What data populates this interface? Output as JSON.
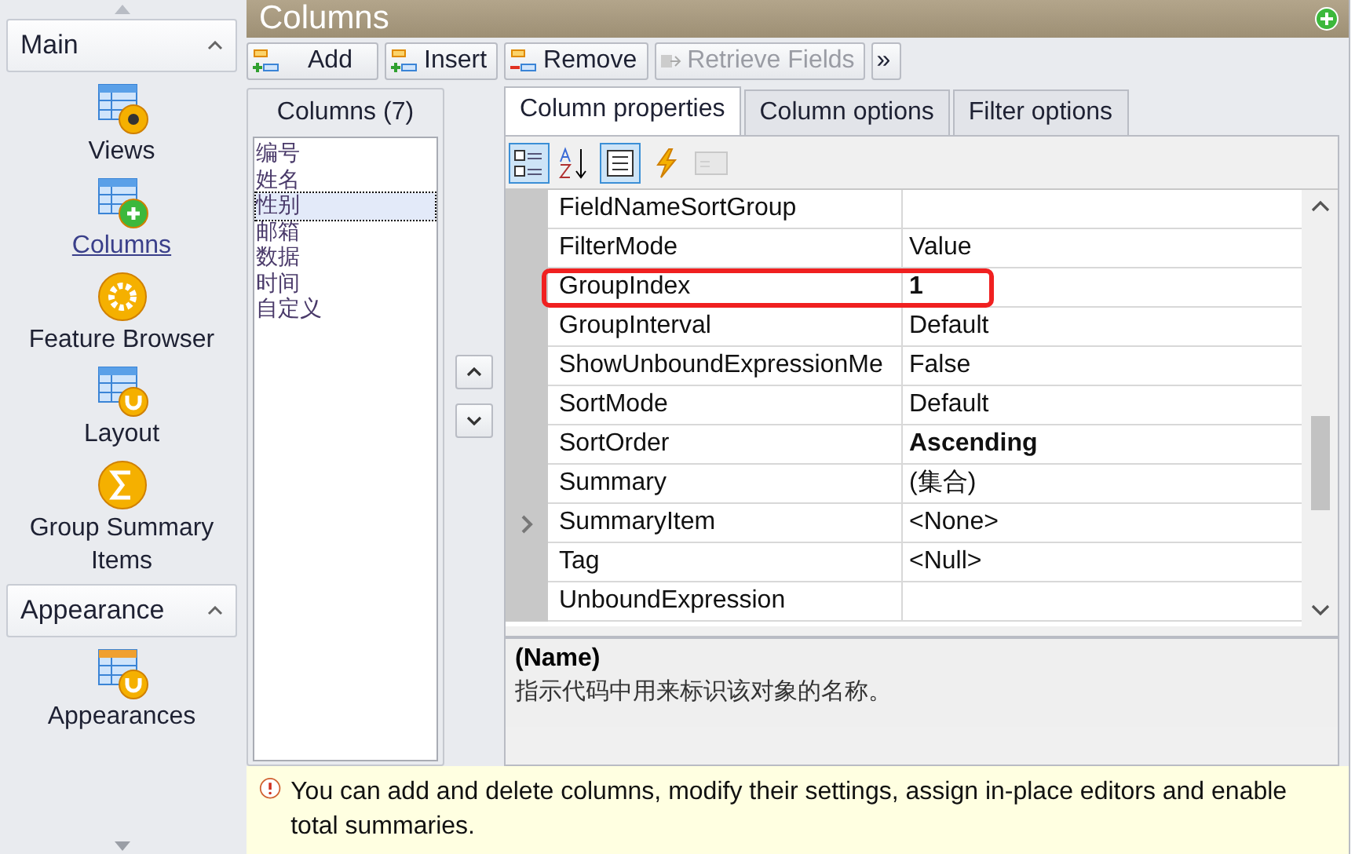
{
  "sidebar": {
    "groups": [
      {
        "title": "Main",
        "expanded": true,
        "items": [
          {
            "label": "Views",
            "kind": "view",
            "selected": false
          },
          {
            "label": "Columns",
            "kind": "columns",
            "selected": true
          },
          {
            "label": "Feature Browser",
            "kind": "feature",
            "selected": false
          },
          {
            "label": "Layout",
            "kind": "layout",
            "selected": false
          },
          {
            "label": "Group Summary Items",
            "kind": "summary",
            "selected": false
          }
        ]
      },
      {
        "title": "Appearance",
        "expanded": true,
        "items": [
          {
            "label": "Appearances",
            "kind": "appearance",
            "selected": false
          }
        ]
      }
    ]
  },
  "window": {
    "title": "Columns"
  },
  "toolbar": [
    {
      "label": "Add",
      "kind": "add",
      "disabled": false
    },
    {
      "label": "Insert",
      "kind": "insert",
      "disabled": false
    },
    {
      "label": "Remove",
      "kind": "remove",
      "disabled": false
    },
    {
      "label": "Retrieve Fields",
      "kind": "retrieve",
      "disabled": true
    },
    {
      "label": "»",
      "kind": "more",
      "disabled": false
    }
  ],
  "columns_panel": {
    "title": "Columns (7)",
    "items": [
      {
        "label": "编号",
        "selected": false
      },
      {
        "label": "姓名",
        "selected": false
      },
      {
        "label": "性别",
        "selected": true
      },
      {
        "label": "邮箱",
        "selected": false
      },
      {
        "label": "数据",
        "selected": false
      },
      {
        "label": "时间",
        "selected": false
      },
      {
        "label": "自定义",
        "selected": false
      }
    ]
  },
  "tabs": [
    {
      "label": "Column properties",
      "selected": true
    },
    {
      "label": "Column options",
      "selected": false
    },
    {
      "label": "Filter options",
      "selected": false
    }
  ],
  "grid_toolbar": [
    {
      "kind": "categorized",
      "selected": true,
      "disabled": false
    },
    {
      "kind": "alphabetical",
      "selected": false,
      "disabled": false
    },
    {
      "kind": "properties",
      "selected": true,
      "disabled": false
    },
    {
      "kind": "events",
      "selected": false,
      "disabled": false
    },
    {
      "kind": "pages",
      "selected": false,
      "disabled": true
    }
  ],
  "properties": [
    {
      "name": "FieldNameSortGroup",
      "current": false,
      "highlighted": false
    },
    {
      "name": "FilterMode",
      "value": "Value",
      "modified": false,
      "current": false,
      "highlighted": false
    },
    {
      "name": "GroupIndex",
      "value": "1",
      "modified": true,
      "current": false,
      "highlighted": true
    },
    {
      "name": "GroupInterval",
      "value": "Default",
      "modified": false,
      "current": false,
      "highlighted": false
    },
    {
      "name": "ShowUnboundExpressionMe",
      "value": "False",
      "modified": false,
      "current": false,
      "highlighted": false
    },
    {
      "name": "SortMode",
      "value": "Default",
      "modified": false,
      "current": false,
      "highlighted": false
    },
    {
      "name": "SortOrder",
      "value": "Ascending",
      "modified": true,
      "current": false,
      "highlighted": false
    },
    {
      "name": "Summary",
      "value": "(集合)",
      "modified": false,
      "current": false,
      "highlighted": false
    },
    {
      "name": "SummaryItem",
      "value": "<None>",
      "modified": false,
      "current": true,
      "highlighted": false
    },
    {
      "name": "Tag",
      "value": "<Null>",
      "modified": false,
      "current": false,
      "highlighted": false
    },
    {
      "name": "UnboundExpression",
      "current": false,
      "highlighted": false
    }
  ],
  "description": {
    "title": "(Name)",
    "text": "指示代码中用来标识该对象的名称。"
  },
  "info_bar": {
    "text": "You can add and delete columns, modify their settings, assign in-place editors and enable total summaries."
  }
}
